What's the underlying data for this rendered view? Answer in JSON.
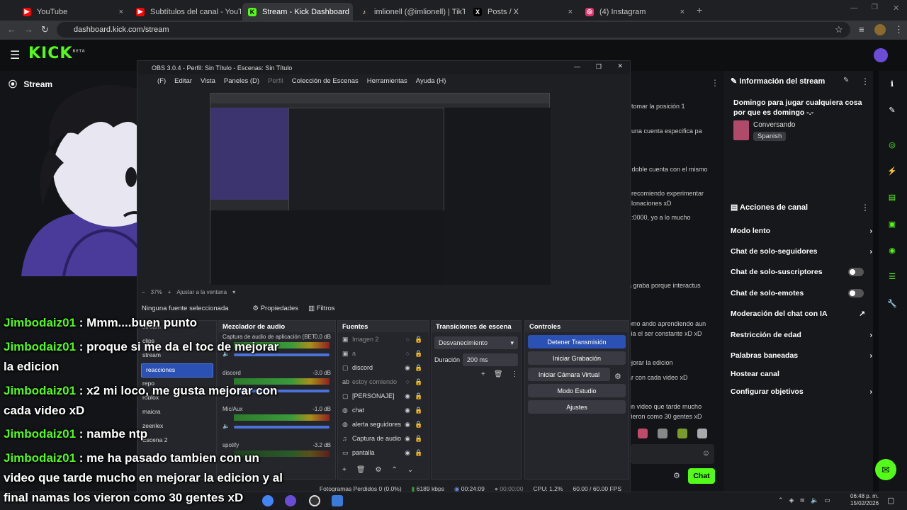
{
  "browser": {
    "tabs": [
      {
        "label": "YouTube",
        "color": "#ff0000"
      },
      {
        "label": "Subtítulos del canal - YouTube",
        "color": "#ff0000"
      },
      {
        "label": "Stream - Kick Dashboard",
        "color": "#53fc18"
      },
      {
        "label": "imlionell (@imlionell) | TikTok",
        "color": "#222222"
      },
      {
        "label": "Posts / X",
        "color": "#000000"
      },
      {
        "label": "(4) Instagram",
        "color": "#e1306c"
      }
    ],
    "url": "dashboard.kick.com/stream"
  },
  "kick": {
    "logo": "KICK",
    "logo_sup": "BETA",
    "stream_label": "Stream",
    "mid_lines": [
      "tomar la posición 1",
      "una cuenta especifica pa",
      "r doble cuenta con el mismo",
      "recomiendo experimentar",
      "lonaciones xD",
      "t :0000, yo a lo mucho",
      "a graba porque interactus",
      "omo ando aprendiendo aun",
      "cia el ser constante xD xD",
      "ejorar la edicion",
      "ar con cada video xD",
      "un video que tarde mucho",
      "vieron como 30 gentes xD"
    ],
    "stream_info": {
      "header": "Información del stream",
      "title": "Domingo para jugar cualquiera cosa por que es domingo -.-",
      "category": "Conversando",
      "language": "Spanish"
    },
    "channel_actions": {
      "header": "Acciones de canal",
      "items": [
        "Modo lento",
        "Chat de solo-seguidores",
        "Chat de solo-suscriptores",
        "Chat de solo-emotes",
        "Moderación del chat con IA",
        "Restricción de edad",
        "Palabras baneadas",
        "Hostear canal",
        "Configurar objetivos"
      ]
    },
    "chat_button": "Chat"
  },
  "obs": {
    "title": "OBS 3.0.4 - Perfil: Sin Título - Escenas: Sin Título",
    "menu": [
      "(F)",
      "Editar",
      "Vista",
      "Paneles (D)",
      "Perfil",
      "Colección de Escenas",
      "Herramientas",
      "Ayuda (H)"
    ],
    "zoom": "37%",
    "fit_label": "Ajustar a la ventana",
    "no_source": "Ninguna fuente seleccionada",
    "properties": "Propiedades",
    "filters": "Filtros",
    "scenes": [
      "stream",
      "clips",
      "stream",
      "reacciones",
      "repo",
      "roblox",
      "maicra",
      "zeenlex",
      "Escena 2"
    ],
    "mixer": {
      "header": "Mezclador de audio",
      "channels": [
        {
          "name": "Captura de audio de aplicación (BET",
          "db": "0.0 dB"
        },
        {
          "name": "discord",
          "db": "-3.0 dB"
        },
        {
          "name": "Mic/Aux",
          "db": "-1.0 dB"
        },
        {
          "name": "spotify",
          "db": "-3.2 dB"
        }
      ]
    },
    "sources": {
      "header": "Fuentes",
      "items": [
        "Imagen 2",
        "a",
        "discord",
        "estoy comiendo",
        "[PERSONAJE]",
        "chat",
        "alerta seguidores",
        "Captura de audio",
        "pantalla"
      ]
    },
    "transitions": {
      "header": "Transiciones de escena",
      "selected": "Desvanecimiento",
      "duration_label": "Duración",
      "duration": "200 ms"
    },
    "controls": {
      "header": "Controles",
      "buttons": [
        "Detener Transmisión",
        "Iniciar Grabación",
        "Iniciar Cámara Virtual",
        "Modo Estudio",
        "Ajustes"
      ]
    },
    "status": {
      "dropped": "Fotogramas Perdidos 0 (0.0%)",
      "bitrate": "6189 kbps",
      "live": "00:24:09",
      "rec": "00:00:00",
      "cpu": "CPU: 1.2%",
      "fps": "60.00 / 60.00 FPS"
    }
  },
  "chat_overlay": [
    {
      "user": "Jimbodaiz01",
      "text": ": Mmm....buen punto"
    },
    {
      "user": "Jimbodaiz01",
      "text": ": proque si me da el toc de mejorar",
      "cont": "la edicion"
    },
    {
      "user": "Jimbodaiz01",
      "text": ": x2 mi loco, me gusta mejorar con",
      "cont": "cada video xD"
    },
    {
      "user": "Jimbodaiz01",
      "text": ": nambe ntp"
    },
    {
      "user": "Jimbodaiz01",
      "text": ": me ha pasado tambien con un",
      "cont": "video que tarde mucho en mejorar la edicion y al",
      "cont2": "final namas los vieron como 30 gentes xD"
    }
  ],
  "taskbar": {
    "time": "06:48 p. m.",
    "date": "15/02/2026"
  }
}
